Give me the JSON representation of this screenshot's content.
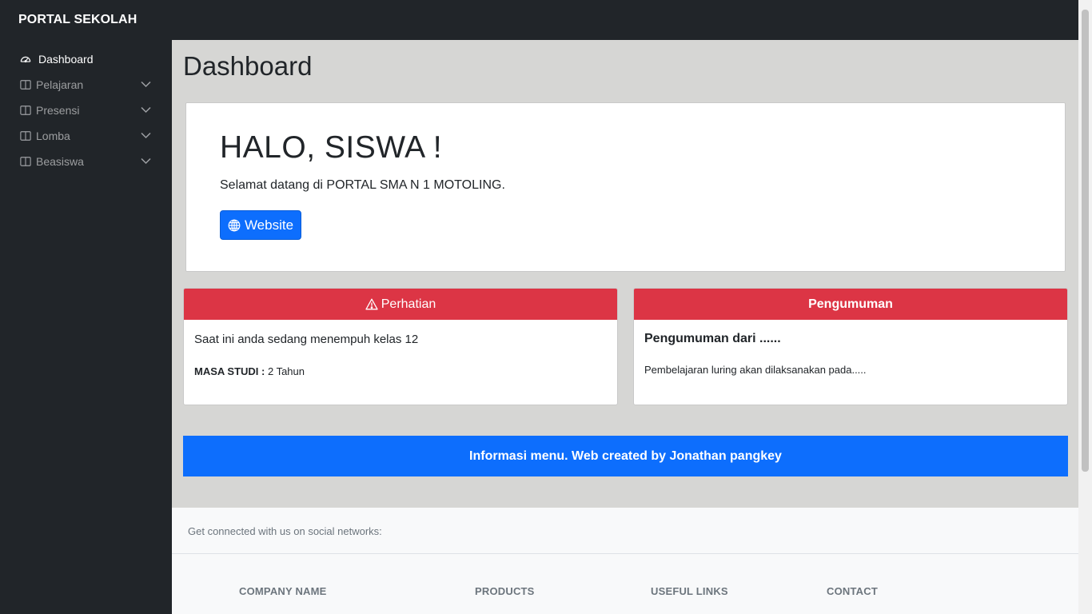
{
  "brand": "PORTAL SEKOLAH",
  "sidebar": {
    "items": [
      {
        "label": "Dashboard",
        "icon": "speedometer-icon",
        "active": true
      },
      {
        "label": "Pelajaran",
        "icon": "layout-columns-icon",
        "expandable": true
      },
      {
        "label": "Presensi",
        "icon": "layout-columns-icon",
        "expandable": true
      },
      {
        "label": "Lomba",
        "icon": "layout-columns-icon",
        "expandable": true
      },
      {
        "label": "Beasiswa",
        "icon": "layout-columns-icon",
        "expandable": true
      }
    ]
  },
  "main": {
    "title": "Dashboard",
    "hero": {
      "heading": "HALO, SISWA !",
      "text": "Selamat datang di PORTAL SMA N 1 MOTOLING.",
      "button_label": "Website",
      "button_icon": "globe-icon"
    },
    "attention_card": {
      "header": "Perhatian",
      "header_icon": "warning-triangle-icon",
      "line1": "Saat ini anda sedang menempuh kelas 12",
      "study_label": "MASA STUDI :",
      "study_value": " 2 Tahun"
    },
    "announcement_card": {
      "header": "Pengumuman",
      "title": "Pengumuman dari ......",
      "text": "Pembelajaran luring akan dilaksanakan pada....."
    },
    "info_bar": "Informasi menu. Web created by Jonathan pangkey"
  },
  "footer": {
    "social_text": "Get connected with us on social networks:",
    "columns": [
      "COMPANY NAME",
      "PRODUCTS",
      "USEFUL LINKS",
      "CONTACT"
    ]
  },
  "colors": {
    "primary": "#0d6efd",
    "danger": "#dc3545",
    "dark": "#212529",
    "content_bg": "#d6d6d4"
  }
}
